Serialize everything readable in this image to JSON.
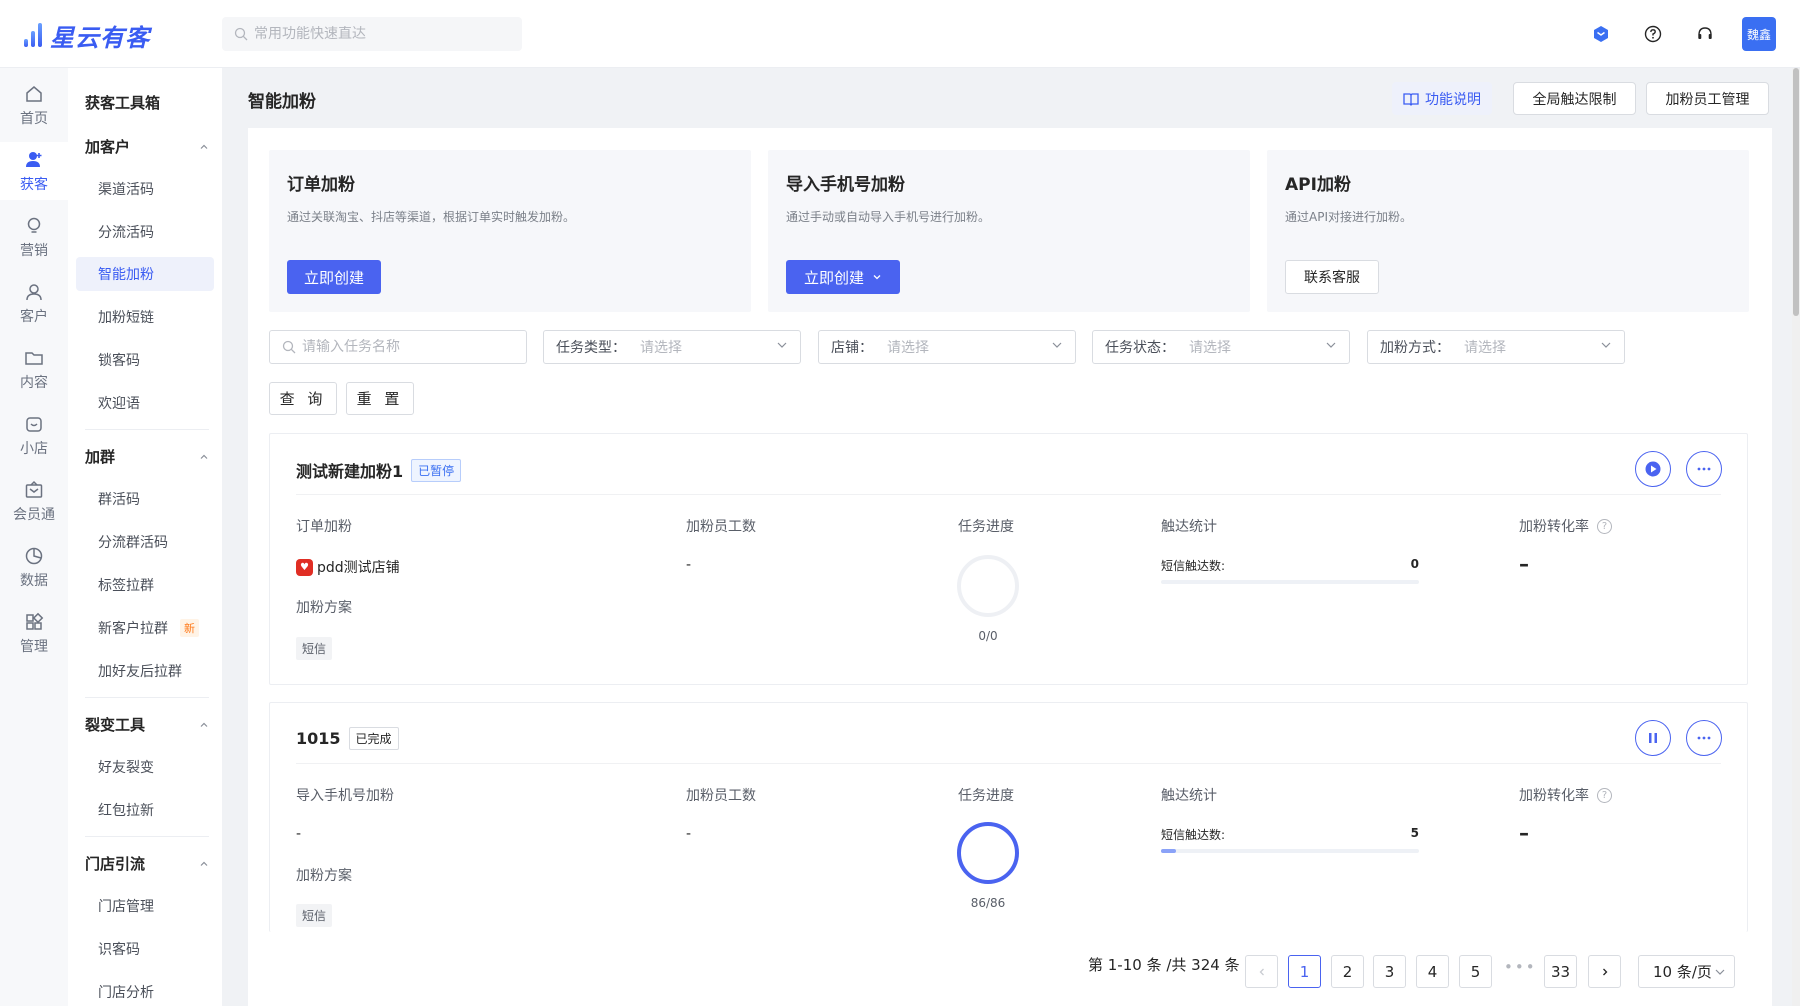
{
  "app": {
    "logo": "星云有客"
  },
  "search": {
    "placeholder": "常用功能快速直达"
  },
  "user": {
    "avatar_text": "魏鑫"
  },
  "rail": [
    {
      "label": "首页",
      "icon": "home-icon"
    },
    {
      "label": "获客",
      "icon": "user-add-icon"
    },
    {
      "label": "营销",
      "icon": "bulb-icon"
    },
    {
      "label": "客户",
      "icon": "user-icon"
    },
    {
      "label": "内容",
      "icon": "folder-icon"
    },
    {
      "label": "小店",
      "icon": "shop-icon"
    },
    {
      "label": "会员通",
      "icon": "member-icon"
    },
    {
      "label": "数据",
      "icon": "pie-chart-icon"
    },
    {
      "label": "管理",
      "icon": "apps-icon"
    }
  ],
  "submenu": {
    "title": "获客工具箱",
    "groups": [
      {
        "label": "加客户",
        "items": [
          "渠道活码",
          "分流活码",
          "智能加粉",
          "加粉短链",
          "锁客码",
          "欢迎语"
        ]
      },
      {
        "label": "加群",
        "items": [
          "群活码",
          "分流群活码",
          "标签拉群",
          "新客户拉群",
          "加好友后拉群"
        ],
        "new_badge": "新"
      },
      {
        "label": "裂变工具",
        "items": [
          "好友裂变",
          "红包拉新"
        ]
      },
      {
        "label": "门店引流",
        "items": [
          "门店管理",
          "识客码",
          "门店分析"
        ]
      }
    ]
  },
  "page": {
    "title": "智能加粉",
    "info_label": "功能说明",
    "limit_label": "全局触达限制",
    "staff_label": "加粉员工管理"
  },
  "cards": [
    {
      "title": "订单加粉",
      "desc": "通过关联淘宝、抖店等渠道，根据订单实时触发加粉。",
      "button": "立即创建"
    },
    {
      "title": "导入手机号加粉",
      "desc": "通过手动或自动导入手机号进行加粉。",
      "button": "立即创建"
    },
    {
      "title": "API加粉",
      "desc": "通过API对接进行加粉。",
      "button": "联系客服"
    }
  ],
  "filters": {
    "name_placeholder": "请输入任务名称",
    "type_label": "任务类型：",
    "shop_label": "店铺：",
    "status_label": "任务状态：",
    "method_label": "加粉方式：",
    "select_placeholder": "请选择",
    "query": "查 询",
    "reset": "重 置"
  },
  "columns": {
    "staff": "加粉员工数",
    "progress": "任务进度",
    "reach": "触达统计",
    "rate": "加粉转化率",
    "plan": "加粉方案"
  },
  "tasks": [
    {
      "name": "测试新建加粉1",
      "status": "已暂停",
      "type": "订单加粉",
      "source": "pdd测试店铺",
      "staff": "-",
      "progress_text": "0/0",
      "progress": 0,
      "reach_label": "短信触达数:",
      "reach_value": "0",
      "reach_fill": 0,
      "rate": "–",
      "plan_tag": "短信"
    },
    {
      "name": "1015",
      "status": "已完成",
      "type": "导入手机号加粉",
      "source": "-",
      "staff": "-",
      "progress_text": "86/86",
      "progress": 1,
      "reach_label": "短信触达数:",
      "reach_value": "5",
      "reach_fill": 0.06,
      "rate": "–",
      "plan_tag": "短信"
    }
  ],
  "pagination": {
    "summary": "第 1-10 条 /共 324 条",
    "pages": [
      "1",
      "2",
      "3",
      "4",
      "5"
    ],
    "ellipsis": "•••",
    "last": "33",
    "current": 1,
    "page_size": "10 条/页"
  },
  "colors": {
    "primary": "#4a63f0",
    "brand": "#3a5cf2"
  }
}
